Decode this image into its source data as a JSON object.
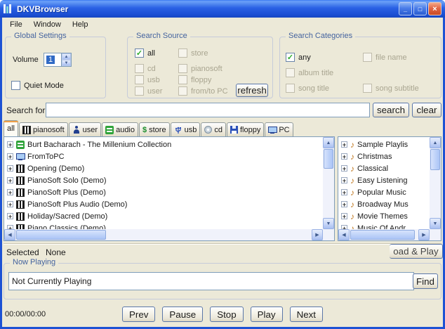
{
  "icons": {
    "check": "✓",
    "note": "♪",
    "dollar": "$",
    "plus": "+",
    "arrow_up": "▲",
    "arrow_down": "▼",
    "arrow_left": "◀",
    "arrow_right": "▶",
    "minimize": "_",
    "maximize": "□",
    "close": "×"
  },
  "titlebar": {
    "title": "DKVBrowser"
  },
  "menubar": {
    "items": [
      "File",
      "Window",
      "Help"
    ]
  },
  "global_settings": {
    "title": "Global Settings",
    "volume_label": "Volume",
    "volume_value": "1",
    "quiet_mode": "Quiet Mode"
  },
  "search_source": {
    "title": "Search Source",
    "options": [
      "all",
      "store",
      "cd",
      "pianosoft",
      "usb",
      "floppy",
      "user",
      "from/to PC"
    ],
    "refresh": "refresh"
  },
  "search_categories": {
    "title": "Search Categories",
    "options": [
      "any",
      "file name",
      "album title",
      "song title",
      "song subtitle"
    ]
  },
  "search": {
    "label": "Search for",
    "value": "",
    "search_button": "search",
    "clear_button": "clear"
  },
  "tabs": {
    "items": [
      {
        "label": "all",
        "icon": ""
      },
      {
        "label": "pianosoft",
        "icon": "piano-icon"
      },
      {
        "label": "user",
        "icon": "user-icon"
      },
      {
        "label": "audio",
        "icon": "sync-icon"
      },
      {
        "label": "store",
        "icon": "dollar-icon"
      },
      {
        "label": "usb",
        "icon": "usb-icon"
      },
      {
        "label": "cd",
        "icon": "cd-icon"
      },
      {
        "label": "floppy",
        "icon": "floppy-icon"
      },
      {
        "label": "PC",
        "icon": "pc-icon"
      }
    ]
  },
  "tree": {
    "items": [
      {
        "label": "Burt Bacharach - The Millenium Collection",
        "icon": "sync-icon"
      },
      {
        "label": "FromToPC",
        "icon": "pc-icon"
      },
      {
        "label": "Opening (Demo)",
        "icon": "piano-icon"
      },
      {
        "label": "PianoSoft Solo (Demo)",
        "icon": "piano-icon"
      },
      {
        "label": "PianoSoft Plus (Demo)",
        "icon": "piano-icon"
      },
      {
        "label": "PianoSoft Plus Audio (Demo)",
        "icon": "piano-icon"
      },
      {
        "label": "Holiday/Sacred (Demo)",
        "icon": "piano-icon"
      },
      {
        "label": "Piano Classics (Demo)",
        "icon": "piano-icon"
      }
    ]
  },
  "playlists": {
    "items": [
      {
        "label": "Sample Playlis",
        "icon": "note-icon"
      },
      {
        "label": "Christmas",
        "icon": "note-icon"
      },
      {
        "label": "Classical",
        "icon": "note-icon"
      },
      {
        "label": "Easy Listening",
        "icon": "note-icon"
      },
      {
        "label": "Popular Music",
        "icon": "note-icon"
      },
      {
        "label": "Broadway Mus",
        "icon": "note-icon"
      },
      {
        "label": "Movie Themes",
        "icon": "note-icon"
      },
      {
        "label": "Music Of Andr",
        "icon": "note-icon"
      }
    ]
  },
  "selected": {
    "label": "Selected",
    "value": "None",
    "load_play_button": "oad & Play"
  },
  "now_playing": {
    "title": "Now Playing",
    "status": "Not Currently Playing",
    "find_button": "Find"
  },
  "transport": {
    "time": "00:00/00:00",
    "buttons": [
      "Prev",
      "Pause",
      "Stop",
      "Play",
      "Next"
    ]
  }
}
